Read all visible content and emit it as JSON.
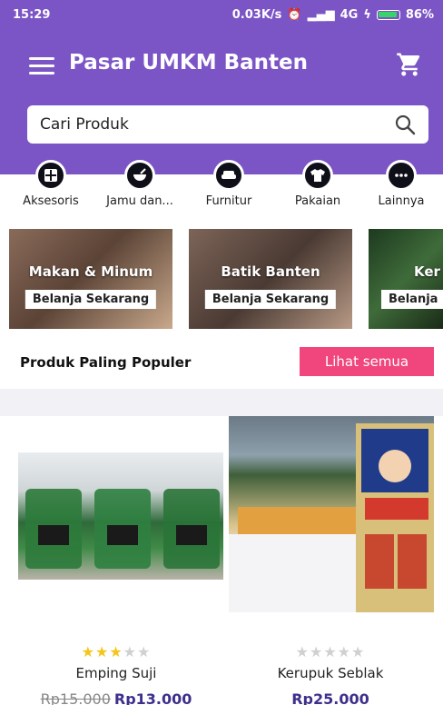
{
  "status": {
    "time": "15:29",
    "speed": "0.03K/s",
    "network": "4G",
    "battery": "86%"
  },
  "app": {
    "title": "Pasar UMKM Banten"
  },
  "search": {
    "placeholder": "Cari Produk"
  },
  "categories": [
    {
      "label": "Aksesoris",
      "icon": "grid-icon"
    },
    {
      "label": "Jamu dan...",
      "icon": "bowl-icon"
    },
    {
      "label": "Furnitur",
      "icon": "sofa-icon"
    },
    {
      "label": "Pakaian",
      "icon": "shirt-icon"
    },
    {
      "label": "Lainnya",
      "icon": "more-icon"
    }
  ],
  "banners": [
    {
      "title": "Makan & Minum",
      "cta": "Belanja Sekarang"
    },
    {
      "title": "Batik Banten",
      "cta": "Belanja Sekarang"
    },
    {
      "title": "Ker",
      "cta": "Belanja"
    }
  ],
  "popular": {
    "title": "Produk Paling Populer",
    "see_all": "Lihat semua"
  },
  "products": [
    {
      "name": "Emping Suji",
      "rating": 3,
      "max_rating": 5,
      "price_old": "Rp15.000",
      "price": "Rp13.000"
    },
    {
      "name": "Kerupuk Seblak",
      "rating": 0,
      "max_rating": 5,
      "price_old": "",
      "price": "Rp25.000"
    }
  ],
  "colors": {
    "primary": "#7b54c6",
    "accent": "#f0457d",
    "price": "#3d2f8c",
    "star": "#f5c518"
  }
}
